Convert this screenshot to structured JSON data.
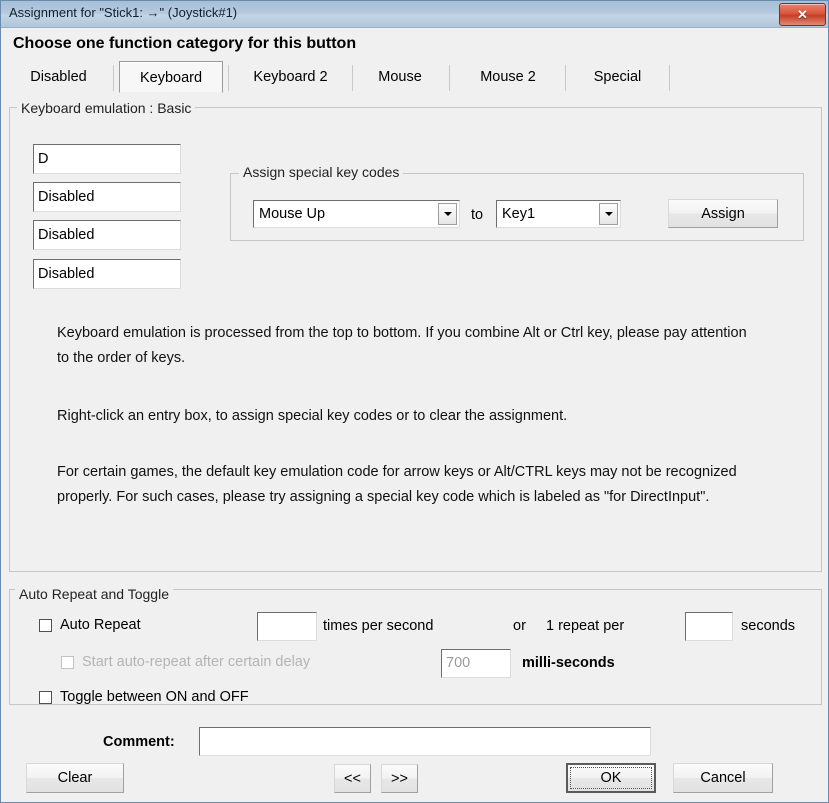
{
  "window": {
    "title": "Assignment for \"Stick1: →\" (Joystick#1)",
    "close_label": "✕",
    "accent_title_bar": "#b2c8de",
    "close_button_color": "#c63f27",
    "dialog_background": "#f0f0f0"
  },
  "headline": "Choose one function category for this button",
  "tabs": [
    {
      "label": "Disabled",
      "selected": false
    },
    {
      "label": "Keyboard",
      "selected": true
    },
    {
      "label": "Keyboard 2",
      "selected": false
    },
    {
      "label": "Mouse",
      "selected": false
    },
    {
      "label": "Mouse 2",
      "selected": false
    },
    {
      "label": "Special",
      "selected": false
    }
  ],
  "keyboard_group": {
    "title": "Keyboard emulation : Basic",
    "entries": [
      {
        "value": "D"
      },
      {
        "value": "Disabled"
      },
      {
        "value": "Disabled"
      },
      {
        "value": "Disabled"
      }
    ],
    "special_keys": {
      "title": "Assign special key codes",
      "source_value": "Mouse Up",
      "to_label": "to",
      "target_value": "Key1",
      "assign_label": "Assign"
    },
    "help": {
      "p1": "Keyboard emulation is processed from the top to bottom.  If you combine Alt or Ctrl key, please pay attention to the order of keys.",
      "p2": "Right-click an entry box, to assign special key codes or to clear the assignment.",
      "p3": "For certain games, the default key emulation code for arrow keys or Alt/CTRL keys may not be recognized properly.  For such cases, please try assigning a special key code which is labeled as \"for DirectInput\"."
    }
  },
  "auto_repeat_group": {
    "title": "Auto Repeat and Toggle",
    "auto_repeat_label": "Auto Repeat",
    "auto_repeat_checked": false,
    "rate_value": "",
    "times_per_second_label": "times per second",
    "or_label": "or",
    "one_repeat_per_label": "1 repeat per",
    "seconds_value": "",
    "seconds_label": "seconds",
    "delay_checkbox_label": "Start auto-repeat after certain delay",
    "delay_checked": false,
    "delay_disabled": true,
    "delay_value": "700",
    "milliseconds_label": "milli-seconds",
    "toggle_label": "Toggle between ON and OFF",
    "toggle_checked": false
  },
  "footer": {
    "comment_label": "Comment:",
    "comment_value": "",
    "clear_label": "Clear",
    "prev_label": "<<",
    "next_label": ">>",
    "ok_label": "OK",
    "cancel_label": "Cancel"
  }
}
